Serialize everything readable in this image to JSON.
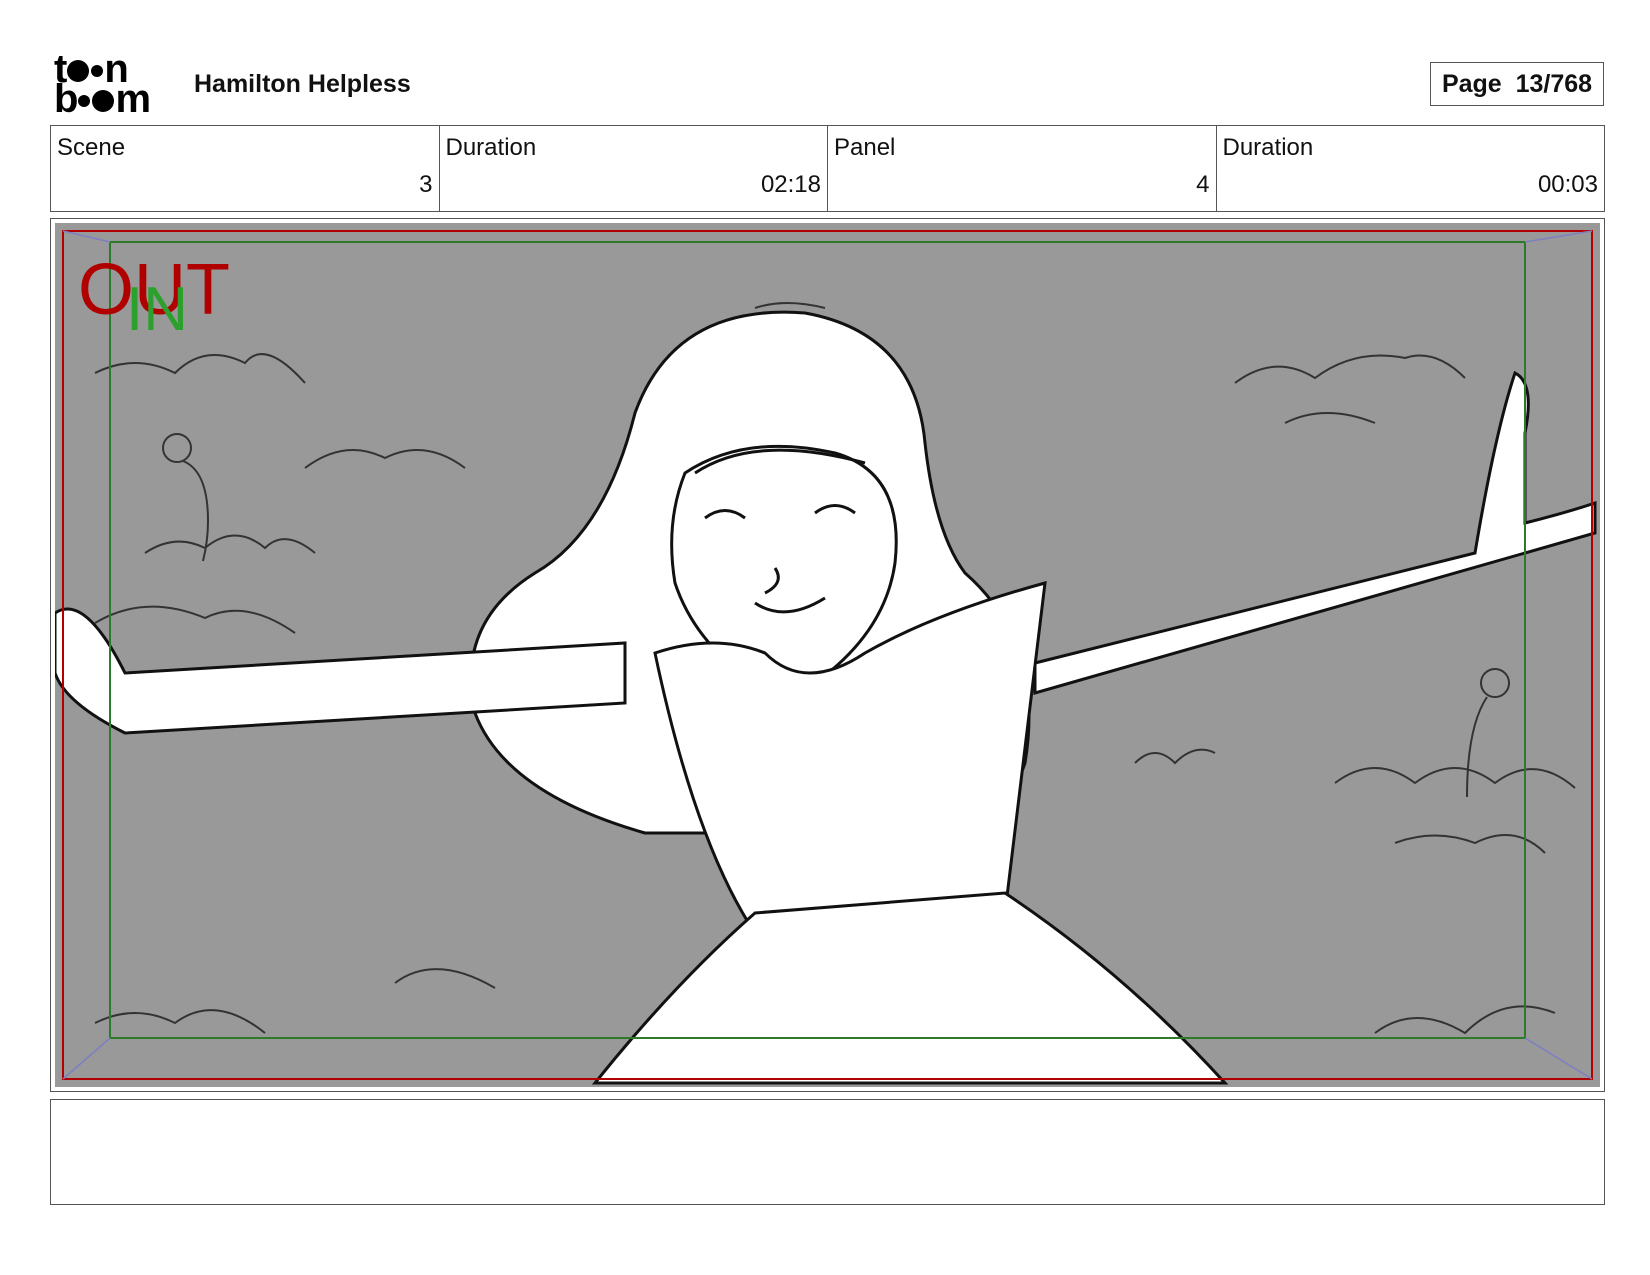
{
  "header": {
    "logo_top": "to n",
    "logo_bottom": "b m",
    "logo_text": "toon boom",
    "title": "Hamilton Helpless",
    "page_label": "Page  13/768"
  },
  "info": {
    "scene_label": "Scene",
    "scene_value": "3",
    "scene_duration_label": "Duration",
    "scene_duration_value": "02:18",
    "panel_label": "Panel",
    "panel_value": "4",
    "panel_duration_label": "Duration",
    "panel_duration_value": "00:03"
  },
  "panel": {
    "out_label": "OUT",
    "in_label": "IN",
    "background_color": "#999999",
    "out_frame_color": "#b00000",
    "in_frame_color": "#2c7a2c"
  },
  "notes": {
    "text": ""
  }
}
